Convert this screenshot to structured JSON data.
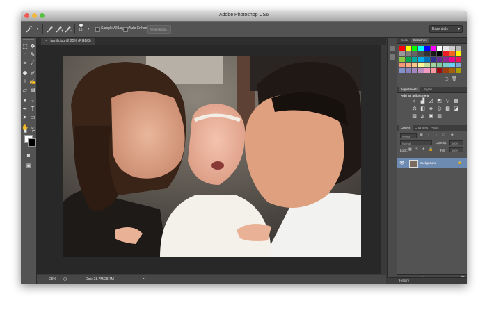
{
  "window": {
    "title": "Adobe Photoshop CS6",
    "traffic_lights": [
      "#ee5b52",
      "#f1b83c",
      "#56c140"
    ]
  },
  "options_bar": {
    "tool_icon": "quick-selection-icon",
    "brush_size": "15",
    "sample_all_layers": "Sample All Layers",
    "auto_enhance": "Auto-Enhance",
    "refine_edge": "Refine Edge...",
    "workspace": "Essentials"
  },
  "tools": [
    "marquee-icon",
    "move-icon",
    "lasso-icon",
    "quick-selection-icon",
    "crop-icon",
    "eyedropper-icon",
    "spot-healing-icon",
    "brush-icon",
    "clone-stamp-icon",
    "history-brush-icon",
    "eraser-icon",
    "gradient-icon",
    "blur-icon",
    "dodge-icon",
    "pen-icon",
    "type-icon",
    "path-selection-icon",
    "rectangle-icon",
    "hand-icon",
    "zoom-icon"
  ],
  "document": {
    "tab": "family.jpg @ 25% (RGB/8)",
    "close": "×"
  },
  "status": {
    "zoom": "25%",
    "doc": "Doc: 28.7M/28.7M"
  },
  "panels": {
    "color_tab": "Color",
    "swatches_tab": "Swatches",
    "adjustments_tab": "Adjustments",
    "styles_tab": "Styles",
    "add_adjustment": "Add an adjustment",
    "layers_tab": "Layers",
    "channels_tab": "Channels",
    "paths_tab": "Paths",
    "kind": "Kind",
    "blend_mode": "Normal",
    "opacity_label": "Opacity:",
    "opacity_value": "100%",
    "lock_label": "Lock:",
    "fill_label": "Fill:",
    "fill_value": "100%",
    "layer_name": "Background",
    "history_tab": "History"
  },
  "swatches": [
    "#ff0000",
    "#ffff00",
    "#00ff00",
    "#00ffff",
    "#0000ff",
    "#ff00ff",
    "#ffffff",
    "#e6e6e6",
    "#cccccc",
    "#b3b3b3",
    "#999999",
    "#808080",
    "#666666",
    "#4d4d4d",
    "#333333",
    "#1a1a1a",
    "#000000",
    "#ed1c24",
    "#f26522",
    "#fff200",
    "#8dc63f",
    "#00a651",
    "#00a99d",
    "#00aeef",
    "#0072bc",
    "#2e3192",
    "#662d91",
    "#92278f",
    "#ec008c",
    "#ed145b",
    "#f7977a",
    "#f9ad81",
    "#fdc68a",
    "#fff79a",
    "#c4df9b",
    "#a3d39c",
    "#82ca9d",
    "#7bcdc8",
    "#6ecff6",
    "#7ea7d8",
    "#8393ca",
    "#8882be",
    "#a187be",
    "#bc8dbf",
    "#f49ac2",
    "#f6989d",
    "#9e0b0f",
    "#a0410d",
    "#a3620a",
    "#aba000"
  ],
  "adjustments": [
    "brightness-icon",
    "levels-icon",
    "curves-icon",
    "exposure-icon",
    "vibrance-icon",
    "hue-saturation-icon",
    "color-balance-icon",
    "black-white-icon",
    "photo-filter-icon",
    "channel-mixer-icon",
    "color-lookup-icon",
    "invert-icon",
    "posterize-icon",
    "threshold-icon",
    "selective-color-icon",
    "gradient-map-icon"
  ]
}
